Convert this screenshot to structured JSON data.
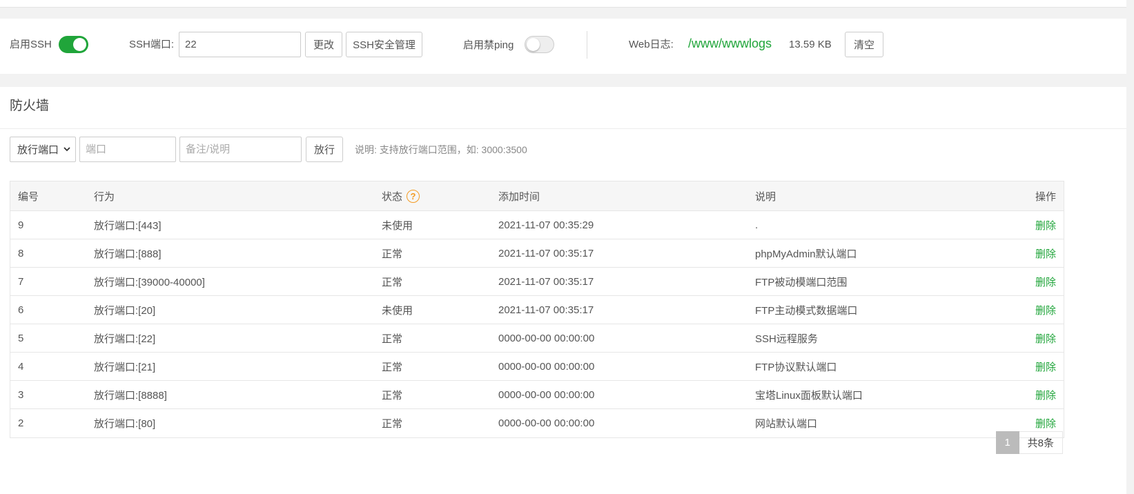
{
  "ssh_bar": {
    "ssh_label": "启用SSH",
    "ssh_enabled": true,
    "port_label": "SSH端口:",
    "port_value": "22",
    "change_button": "更改",
    "ssh_manage_button": "SSH安全管理",
    "ping_label": "启用禁ping",
    "ping_enabled": false,
    "weblog_label": "Web日志:",
    "weblog_path": "/www/wwwlogs",
    "weblog_size": "13.59 KB",
    "clear_button": "清空"
  },
  "firewall": {
    "title": "防火墙",
    "type_select": "放行端口",
    "port_placeholder": "端口",
    "note_placeholder": "备注/说明",
    "allow_button": "放行",
    "hint": "说明: 支持放行端口范围，如: 3000:3500",
    "columns": {
      "id": "编号",
      "action": "行为",
      "status": "状态",
      "time": "添加时间",
      "desc": "说明",
      "op": "操作"
    },
    "rows": [
      {
        "id": "9",
        "action": "放行端口:[443]",
        "status": "未使用",
        "time": "2021-11-07 00:35:29",
        "desc": ".",
        "op": "删除"
      },
      {
        "id": "8",
        "action": "放行端口:[888]",
        "status": "正常",
        "time": "2021-11-07 00:35:17",
        "desc": "phpMyAdmin默认端口",
        "op": "删除"
      },
      {
        "id": "7",
        "action": "放行端口:[39000-40000]",
        "status": "正常",
        "time": "2021-11-07 00:35:17",
        "desc": "FTP被动模端口范围",
        "op": "删除"
      },
      {
        "id": "6",
        "action": "放行端口:[20]",
        "status": "未使用",
        "time": "2021-11-07 00:35:17",
        "desc": "FTP主动模式数据端口",
        "op": "删除"
      },
      {
        "id": "5",
        "action": "放行端口:[22]",
        "status": "正常",
        "time": "0000-00-00 00:00:00",
        "desc": "SSH远程服务",
        "op": "删除"
      },
      {
        "id": "4",
        "action": "放行端口:[21]",
        "status": "正常",
        "time": "0000-00-00 00:00:00",
        "desc": "FTP协议默认端口",
        "op": "删除"
      },
      {
        "id": "3",
        "action": "放行端口:[8888]",
        "status": "正常",
        "time": "0000-00-00 00:00:00",
        "desc": "宝塔Linux面板默认端口",
        "op": "删除"
      },
      {
        "id": "2",
        "action": "放行端口:[80]",
        "status": "正常",
        "time": "0000-00-00 00:00:00",
        "desc": "网站默认端口",
        "op": "删除"
      }
    ],
    "pagination": {
      "current_page": "1",
      "total": "共8条"
    }
  },
  "colors": {
    "accent_green": "#20a53a",
    "help_orange": "#f39b23"
  }
}
